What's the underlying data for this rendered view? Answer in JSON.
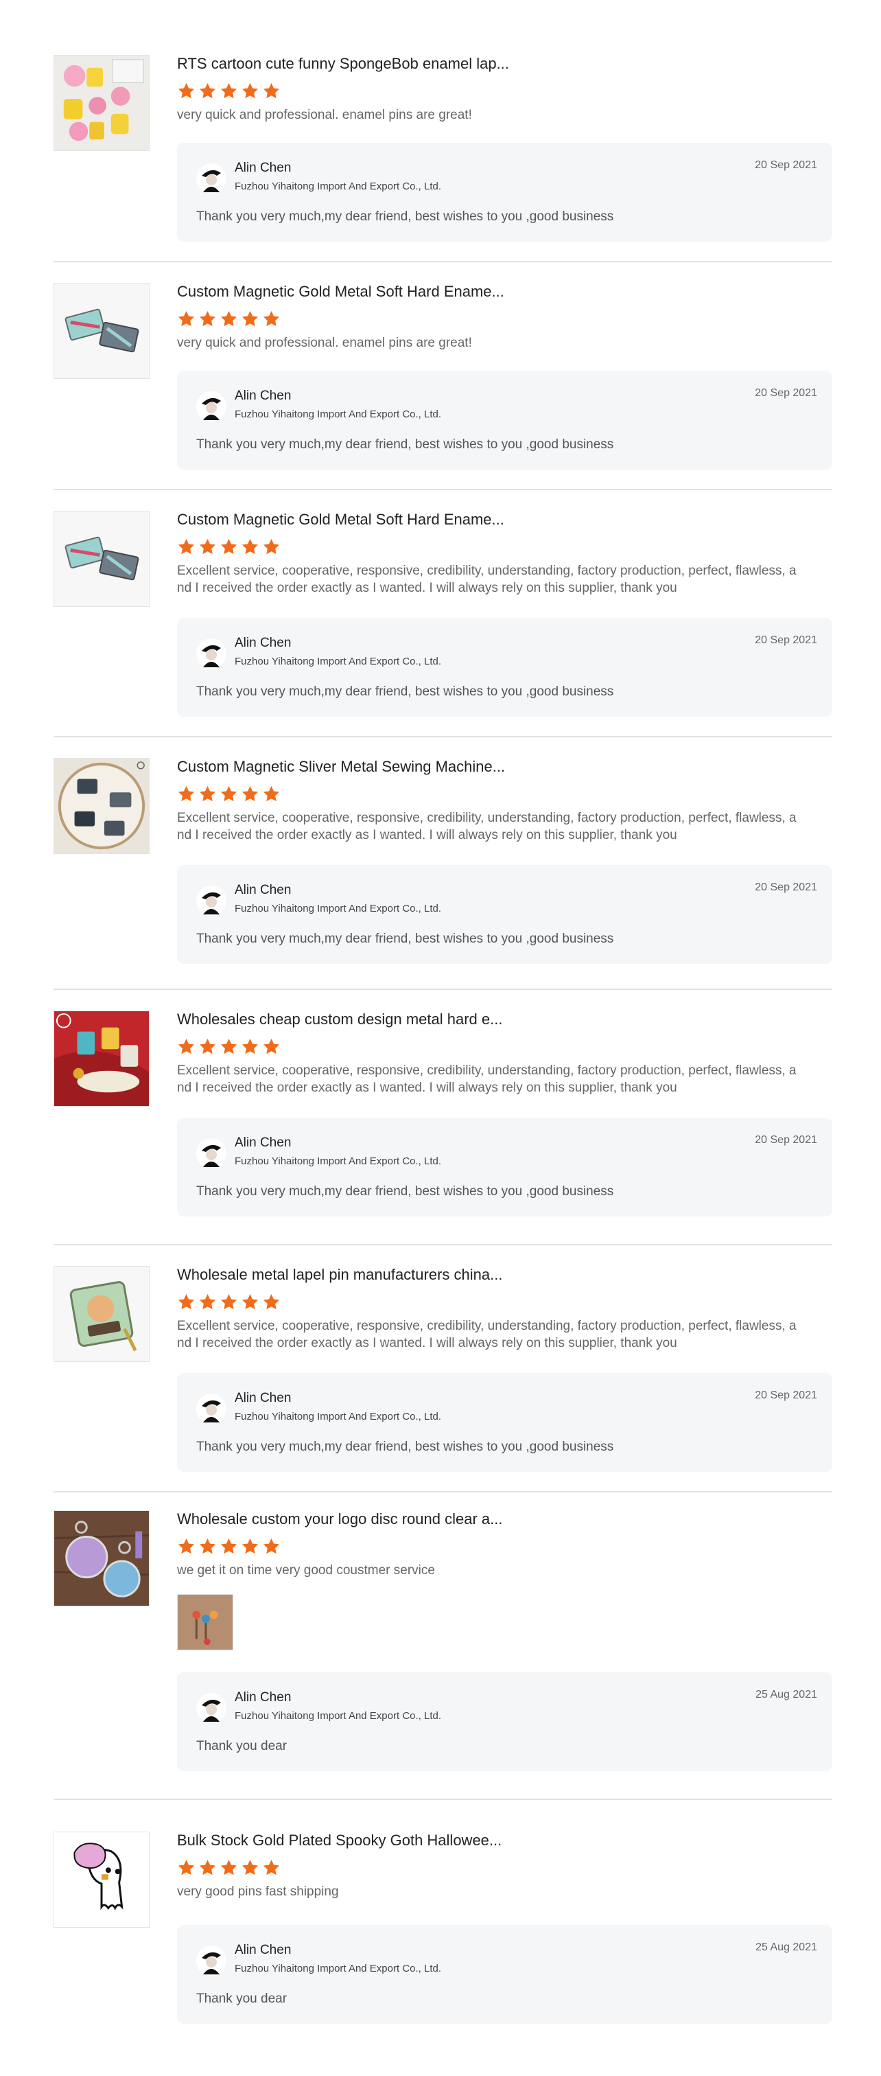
{
  "colors": {
    "star": "#f26b18",
    "reply_bg": "#f5f6f8",
    "divider": "#e2e2e4"
  },
  "reviews": [
    {
      "product_title": "RTS cartoon cute funny SpongeBob enamel lap...",
      "rating": 5,
      "comment": "very quick and professional. enamel pins are great!",
      "thumb_icon": "spongebob-pins-thumbnail",
      "reply": {
        "name": "Alin Chen",
        "company": "Fuzhou Yihaitong Import And Export Co., Ltd.",
        "date": "20 Sep 2021",
        "text": "Thank you very much,my dear friend, best wishes to you ,good business"
      }
    },
    {
      "product_title": "Custom Magnetic Gold Metal Soft Hard Ename...",
      "rating": 5,
      "comment": "very quick and professional. enamel pins are great!",
      "thumb_icon": "magnetic-pins-thumbnail",
      "reply": {
        "name": "Alin Chen",
        "company": "Fuzhou Yihaitong Import And Export Co., Ltd.",
        "date": "20 Sep 2021",
        "text": "Thank you very much,my dear friend, best wishes to you ,good business"
      }
    },
    {
      "product_title": "Custom Magnetic Gold Metal Soft Hard Ename...",
      "rating": 5,
      "comment_line1": "Excellent service, cooperative, responsive, credibility, understanding, factory production, perfect, flawless, a",
      "comment_line2": "nd I received the order exactly as I wanted. I will always rely on this supplier, thank you",
      "thumb_icon": "magnetic-pins-thumbnail",
      "reply": {
        "name": "Alin Chen",
        "company": "Fuzhou Yihaitong Import And Export Co., Ltd.",
        "date": "20 Sep 2021",
        "text": "Thank you very much,my dear friend, best wishes to you ,good business"
      }
    },
    {
      "product_title": "Custom Magnetic Sliver Metal Sewing Machine...",
      "rating": 5,
      "comment_line1": "Excellent service, cooperative, responsive, credibility, understanding, factory production, perfect, flawless, a",
      "comment_line2": "nd I received the order exactly as I wanted. I will always rely on this supplier, thank you",
      "thumb_icon": "sewing-machine-pins-thumbnail",
      "reply": {
        "name": "Alin Chen",
        "company": "Fuzhou Yihaitong Import And Export Co., Ltd.",
        "date": "20 Sep 2021",
        "text": "Thank you very much,my dear friend, best wishes to you ,good business"
      }
    },
    {
      "product_title": "Wholesales cheap custom design metal hard e...",
      "rating": 5,
      "comment_line1": "Excellent service, cooperative, responsive, credibility, understanding, factory production, perfect, flawless, a",
      "comment_line2": "nd I received the order exactly as I wanted. I will always rely on this supplier, thank you",
      "thumb_icon": "christmas-pins-thumbnail",
      "reply": {
        "name": "Alin Chen",
        "company": "Fuzhou Yihaitong Import And Export Co., Ltd.",
        "date": "20 Sep 2021",
        "text": "Thank you very much,my dear friend, best wishes to you ,good business"
      }
    },
    {
      "product_title": "Wholesale metal lapel pin manufacturers china...",
      "rating": 5,
      "comment_line1": "Excellent service, cooperative, responsive, credibility, understanding, factory production, perfect, flawless, a",
      "comment_line2": "nd I received the order exactly as I wanted. I will always rely on this supplier, thank you",
      "thumb_icon": "lapel-pin-thumbnail",
      "reply": {
        "name": "Alin Chen",
        "company": "Fuzhou Yihaitong Import And Export Co., Ltd.",
        "date": "20 Sep 2021",
        "text": "Thank you very much,my dear friend, best wishes to you ,good business"
      }
    },
    {
      "product_title": "Wholesale custom your logo disc round clear a...",
      "rating": 5,
      "comment": "we get it on time very good coustmer service",
      "thumb_icon": "acrylic-keychain-thumbnail",
      "photo_icon": "keychain-photo",
      "reply": {
        "name": "Alin Chen",
        "company": "Fuzhou Yihaitong Import And Export Co., Ltd.",
        "date": "25 Aug 2021",
        "text": "Thank you dear"
      }
    },
    {
      "product_title": "Bulk Stock Gold Plated Spooky Goth Hallowee...",
      "rating": 5,
      "comment": "very good pins fast shipping",
      "thumb_icon": "ghost-pin-thumbnail",
      "reply": {
        "name": "Alin Chen",
        "company": "Fuzhou Yihaitong Import And Export Co., Ltd.",
        "date": "25 Aug 2021",
        "text": "Thank you dear"
      }
    }
  ]
}
